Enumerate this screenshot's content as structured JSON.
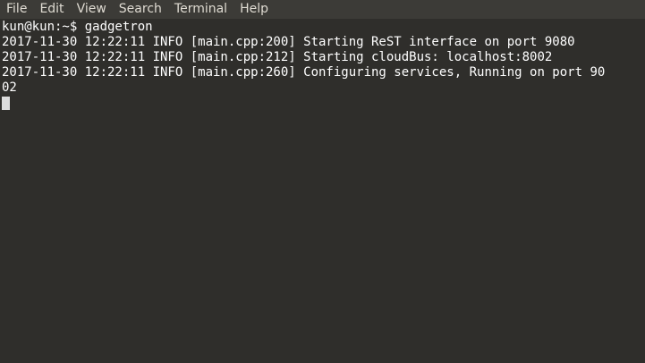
{
  "menubar": {
    "items": [
      {
        "label": "File"
      },
      {
        "label": "Edit"
      },
      {
        "label": "View"
      },
      {
        "label": "Search"
      },
      {
        "label": "Terminal"
      },
      {
        "label": "Help"
      }
    ]
  },
  "terminal": {
    "lines": [
      "kun@kun:~$ gadgetron",
      "2017-11-30 12:22:11 INFO [main.cpp:200] Starting ReST interface on port 9080",
      "2017-11-30 12:22:11 INFO [main.cpp:212] Starting cloudBus: localhost:8002",
      "2017-11-30 12:22:11 INFO [main.cpp:260] Configuring services, Running on port 90",
      "02"
    ]
  },
  "colors": {
    "background": "#2f2e2b",
    "menubar": "#3c3b37",
    "menu_text": "#dfdbd2",
    "terminal_text": "#ffffff",
    "cursor": "#dcdcdc"
  }
}
